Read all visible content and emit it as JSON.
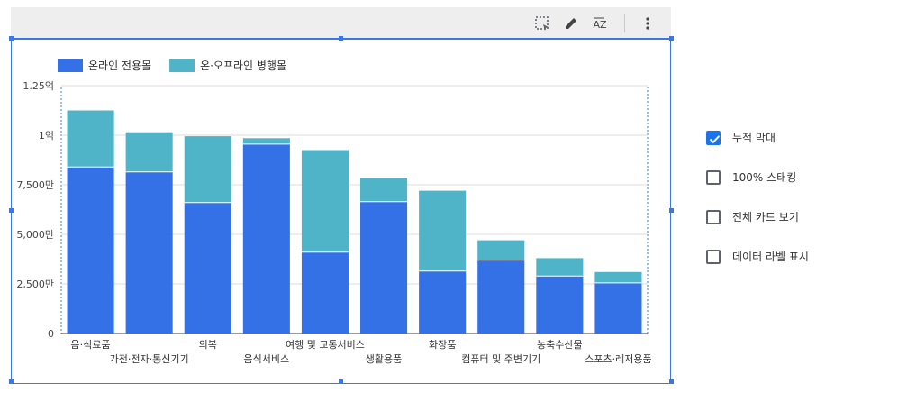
{
  "toolbar": {
    "icons": [
      "select-area-icon",
      "edit-pencil-icon",
      "sort-az-icon",
      "more-vert-icon"
    ],
    "sort_label": "AZ"
  },
  "colors": {
    "series1": "#3471e6",
    "series2": "#4fb4c7",
    "selection": "#3b78e7",
    "checkbox": "#1a73e8"
  },
  "chart_data": {
    "type": "bar",
    "stacked": true,
    "categories": [
      "음·식료품",
      "가전·전자·통신기기",
      "의복",
      "음식서비스",
      "여행 및 교통서비스",
      "생활용품",
      "화장품",
      "컴퓨터 및 주변기기",
      "농축수산물",
      "스포츠·레저용품"
    ],
    "series": [
      {
        "name": "온라인 전용몰",
        "values": [
          84000000,
          81500000,
          66000000,
          95500000,
          41000000,
          66500000,
          31500000,
          37000000,
          29000000,
          25500000
        ]
      },
      {
        "name": "온·오프라인 병행몰",
        "values": [
          28500000,
          20000000,
          33500000,
          3000000,
          51500000,
          12000000,
          40500000,
          10000000,
          9000000,
          5500000
        ]
      }
    ],
    "ylim": [
      0,
      125000000
    ],
    "yticks": [
      {
        "value": 0,
        "label": "0"
      },
      {
        "value": 25000000,
        "label": "2,500만"
      },
      {
        "value": 50000000,
        "label": "5,000만"
      },
      {
        "value": 75000000,
        "label": "7,500만"
      },
      {
        "value": 100000000,
        "label": "1억"
      },
      {
        "value": 125000000,
        "label": "1.25억"
      }
    ],
    "legend_position": "top-left",
    "grid": true
  },
  "options": [
    {
      "label": "누적 막대",
      "checked": true
    },
    {
      "label": "100% 스태킹",
      "checked": false
    },
    {
      "label": "전체 카드 보기",
      "checked": false
    },
    {
      "label": "데이터 라벨 표시",
      "checked": false
    }
  ]
}
